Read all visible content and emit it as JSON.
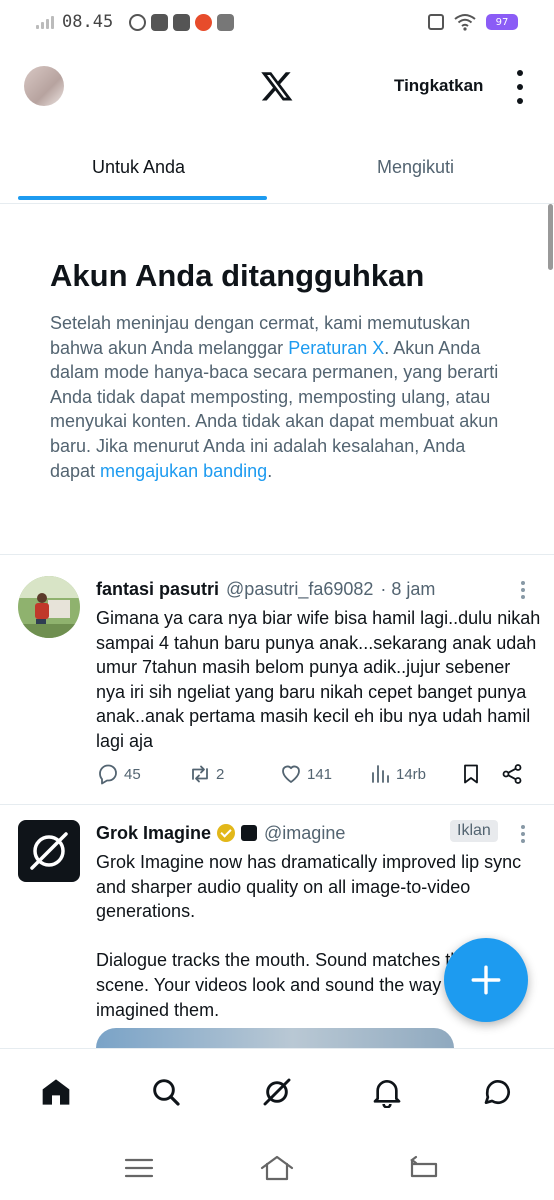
{
  "status_bar": {
    "time": "08.45",
    "battery": "97"
  },
  "header": {
    "upgrade_label": "Tingkatkan"
  },
  "tabs": [
    {
      "label": "Untuk Anda",
      "active": true
    },
    {
      "label": "Mengikuti",
      "active": false
    }
  ],
  "notice": {
    "title": "Akun Anda ditangguhkan",
    "text_1": "Setelah meninjau dengan cermat, kami memutuskan bahwa akun Anda melanggar ",
    "link_1": "Peraturan X",
    "text_2": ". Akun Anda dalam mode hanya-baca secara permanen, yang berarti Anda tidak dapat memposting, memposting ulang, atau menyukai konten. Anda tidak akan dapat membuat akun baru. Jika menurut Anda ini adalah kesalahan, Anda dapat ",
    "link_2": "mengajukan banding",
    "text_3": "."
  },
  "posts": [
    {
      "name": "fantasi pasutri",
      "handle": "@pasutri_fa69082",
      "time": "· 8 jam",
      "text": "Gimana ya cara nya biar wife bisa hamil lagi..dulu nikah sampai 4 tahun baru punya anak...sekarang anak udah umur 7tahun masih belom punya adik..jujur sebener nya iri sih ngeliat yang baru nikah cepet banget punya anak..anak pertama masih kecil eh ibu nya udah hamil lagi aja",
      "replies": "45",
      "reposts": "2",
      "likes": "141",
      "views": "14rb"
    },
    {
      "name": "Grok Imagine",
      "handle": "@imagine",
      "ad_label": "Iklan",
      "text_1": "Grok Imagine now has dramatically improved lip sync and sharper audio quality on all image-to-video generations.",
      "text_2": "Dialogue tracks the mouth. Sound matches the scene. Your videos look and sound the way you imagined them."
    }
  ],
  "colors": {
    "accent": "#1d9bf0",
    "text": "#0f1419",
    "secondary": "#536471",
    "verified": "#e2b719"
  },
  "icons": {
    "bottom_nav": [
      "home-icon",
      "search-icon",
      "grok-icon",
      "notifications-icon",
      "messages-icon"
    ],
    "system_nav": [
      "menu-icon",
      "home-outline-icon",
      "back-icon"
    ]
  }
}
